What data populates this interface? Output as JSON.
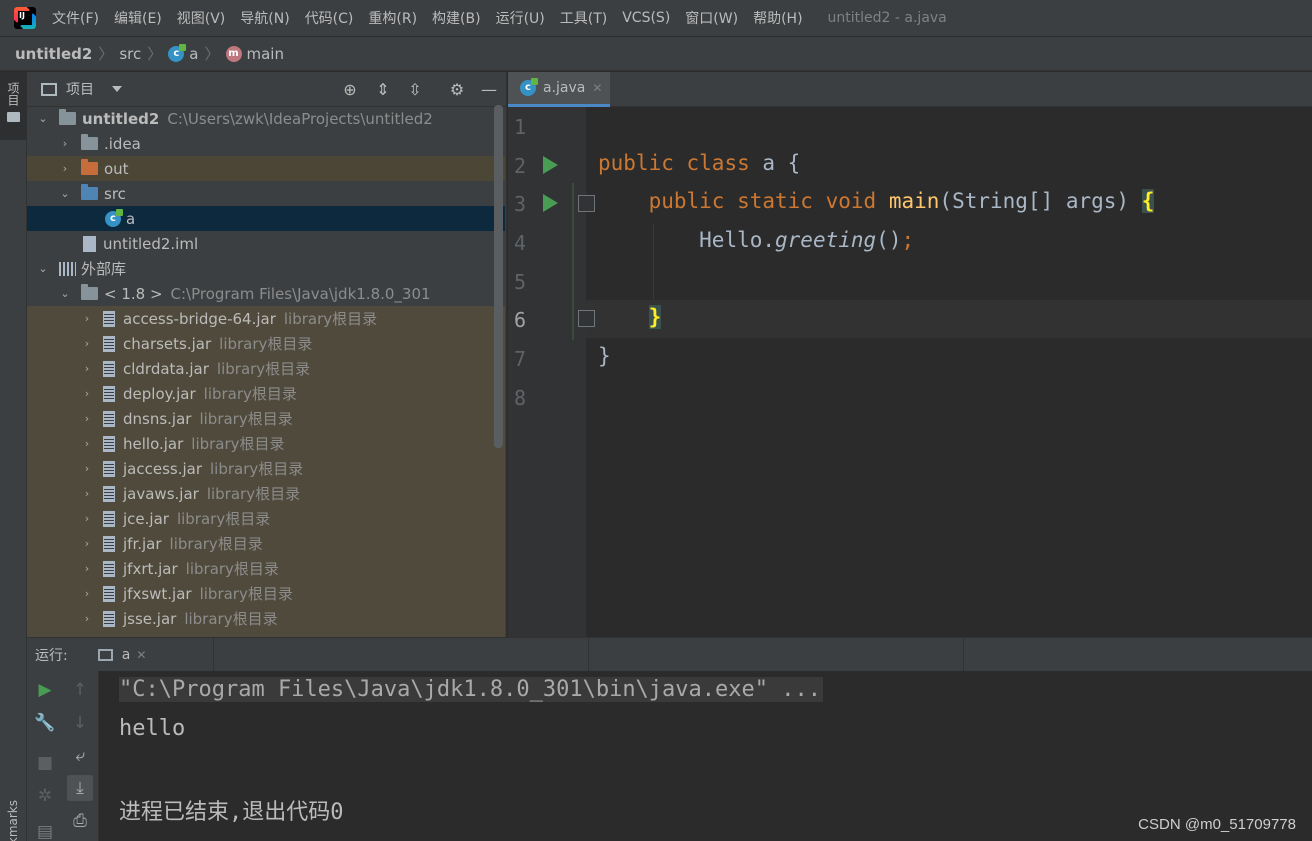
{
  "menu": {
    "items": [
      "文件(F)",
      "编辑(E)",
      "视图(V)",
      "导航(N)",
      "代码(C)",
      "重构(R)",
      "构建(B)",
      "运行(U)",
      "工具(T)",
      "VCS(S)",
      "窗口(W)",
      "帮助(H)"
    ],
    "window_title": "untitled2 - a.java"
  },
  "breadcrumb": {
    "project": "untitled2",
    "folder": "src",
    "class": "a",
    "method": "main"
  },
  "left_strip": {
    "project_tab": "项目",
    "bookmarks_tab": "Bookmarks"
  },
  "project_panel": {
    "title": "项目",
    "tree": {
      "root": {
        "name": "untitled2",
        "path": "C:\\Users\\zwk\\IdeaProjects\\untitled2"
      },
      "idea": ".idea",
      "out": "out",
      "src": "src",
      "class_a": "a",
      "iml": "untitled2.iml",
      "ext_libs": "外部库",
      "jdk": {
        "name": "< 1.8 >",
        "path": "C:\\Program Files\\Java\\jdk1.8.0_301"
      },
      "library_suffix": "library根目录",
      "jars": [
        "access-bridge-64.jar",
        "charsets.jar",
        "cldrdata.jar",
        "deploy.jar",
        "dnsns.jar",
        "hello.jar",
        "jaccess.jar",
        "javaws.jar",
        "jce.jar",
        "jfr.jar",
        "jfxrt.jar",
        "jfxswt.jar",
        "jsse.jar"
      ]
    }
  },
  "editor": {
    "tab": {
      "label": "a.java"
    },
    "line_numbers": [
      "1",
      "2",
      "3",
      "4",
      "5",
      "6",
      "7",
      "8"
    ],
    "code": {
      "l2_kw1": "public",
      "l2_kw2": "class",
      "l2_rest": " a {",
      "l3_kw1": "public",
      "l3_kw2": "static",
      "l3_kw3": "void",
      "l3_fn": "main",
      "l3_rest": "(String[] args) ",
      "l3_brace": "{",
      "l4_obj": "Hello.",
      "l4_call": "greeting",
      "l4_rest": "()",
      "l4_semi": ";",
      "l6_brace": "}",
      "l7_brace": "}"
    }
  },
  "run_panel": {
    "label": "运行:",
    "tab_label": "a",
    "console": {
      "cmd": "\"C:\\Program Files\\Java\\jdk1.8.0_301\\bin\\java.exe\" ...",
      "output": "hello",
      "exit": "进程已结束,退出代码0"
    }
  },
  "watermark": "CSDN @m0_51709778",
  "colors": {
    "keyword": "#cc7832",
    "function": "#ffc66d",
    "accent": "#4a88c7",
    "run_green": "#499c54"
  }
}
